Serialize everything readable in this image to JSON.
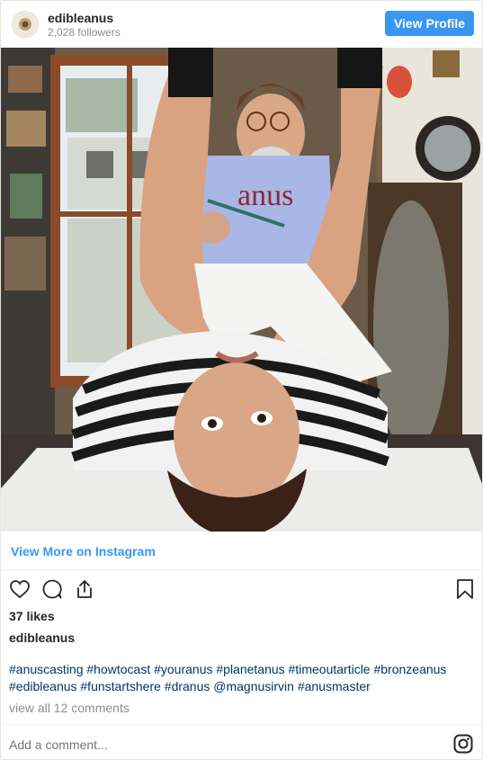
{
  "header": {
    "username": "edibleanus",
    "followers": "2,028 followers",
    "view_profile_label": "View Profile",
    "avatar_icon": "profile-avatar-icon"
  },
  "photo": {
    "apron_text": "anus"
  },
  "links": {
    "view_more": "View More on Instagram"
  },
  "actions": {
    "icons": [
      "heart-icon",
      "comment-icon",
      "share-icon",
      "bookmark-icon"
    ]
  },
  "post": {
    "likes": "37 likes",
    "caption_username": "edibleanus",
    "hashtags_line1": "#anuscasting #howtocast #youranus #planetanus #timeoutarticle #bronzeanus",
    "hashtags_line2": "#edibleanus #funstartshere #dranus @magnusirvin #anusmaster",
    "view_comments": "view all 12 comments"
  },
  "comment_box": {
    "placeholder": "Add a comment..."
  },
  "colors": {
    "accent": "#3897f0",
    "hashtag": "#003569",
    "muted": "#8e8e8e",
    "text": "#262626"
  }
}
